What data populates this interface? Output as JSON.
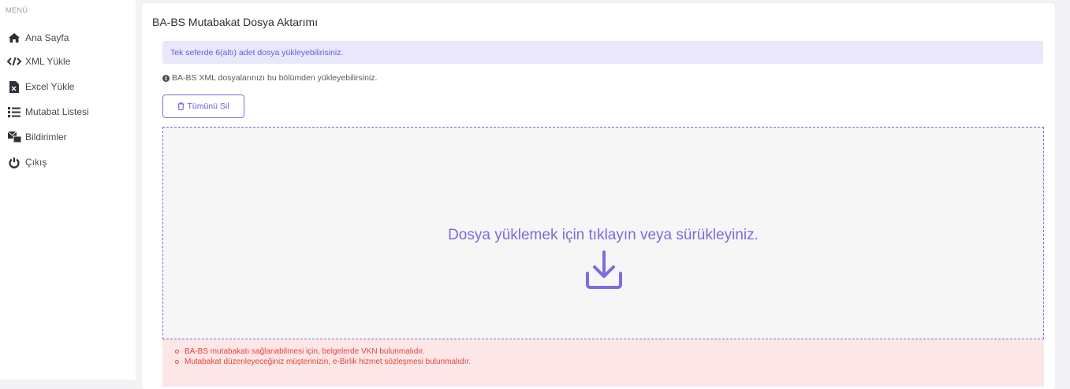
{
  "sidebar": {
    "menu_title": "MENÜ",
    "items": [
      {
        "label": "Ana Sayfa",
        "icon": "home-icon"
      },
      {
        "label": "XML Yükle",
        "icon": "code-icon"
      },
      {
        "label": "Excel Yükle",
        "icon": "excel-file-icon"
      },
      {
        "label": "Mutabat Listesi",
        "icon": "list-icon"
      },
      {
        "label": "Bildirimler",
        "icon": "notification-icon"
      },
      {
        "label": "Çıkış",
        "icon": "power-icon"
      }
    ]
  },
  "main": {
    "title": "BA-BS Mutabakat Dosya Aktarımı",
    "info_alert": "Tek seferde 6(altı) adet dosya yükleyebilirisiniz.",
    "hint": "BA-BS XML dosyalarınızı bu bölümden yükleyebilirsiniz.",
    "delete_all_label": "Tümünü Sil",
    "dropzone_text": "Dosya yüklemek için tıklayın veya sürükleyiniz.",
    "requirements": [
      "BA-BS mutabakatı sağlanabilmesi için, belgelerde VKN bulunmalıdır.",
      "Mutabakat düzenleyeceğiniz müşterinizin, e-Birlik hizmet sözleşmesi bulunmalıdır."
    ]
  },
  "colors": {
    "accent": "#7b6ee0",
    "info_bg": "#e9e7fb",
    "error_text": "#e0443f",
    "error_bg": "#fde6e6"
  }
}
